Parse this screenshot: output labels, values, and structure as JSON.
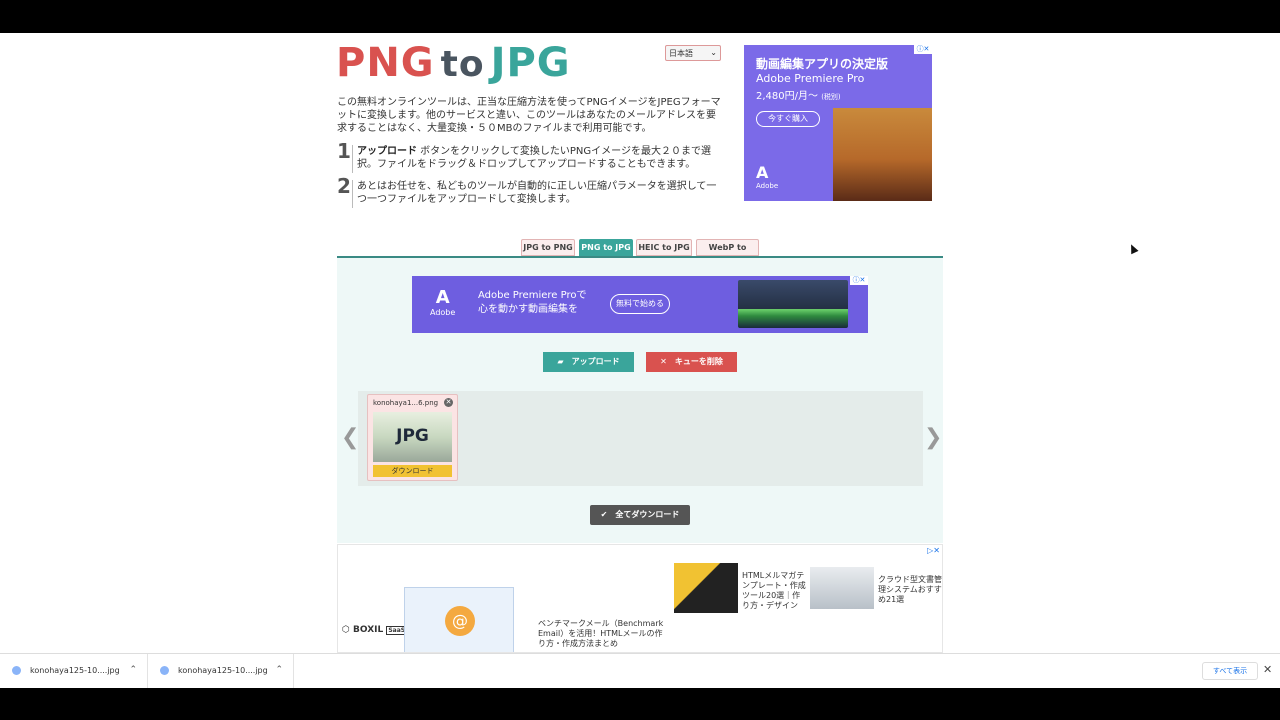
{
  "header": {
    "logo_left": "PNG",
    "logo_mid": "to",
    "logo_right": "JPG",
    "language": "日本語",
    "intro": "この無料オンラインツールは、正当な圧縮方法を使ってPNGイメージをJPEGフォーマットに変換します。他のサービスと違い、このツールはあなたのメールアドレスを要求することはなく、大量変換・５０MBのファイルまで利用可能です。",
    "steps": [
      {
        "num": "1",
        "bold": "アップロード",
        "text": " ボタンをクリックして変換したいPNGイメージを最大２０まで選択。ファイルをドラッグ＆ドロップしてアップロードすることもできます。"
      },
      {
        "num": "2",
        "bold": "",
        "text": "あとはお任せを、私どものツールが自動的に正しい圧縮パラメータを選択して一つ一つファイルをアップロードして変換します。"
      }
    ]
  },
  "ad_right": {
    "title": "動画編集アプリの決定版",
    "product": "Adobe Premiere Pro",
    "price": "2,480円/月～",
    "tax": "(税別)",
    "button": "今すぐ購入",
    "brand": "Adobe"
  },
  "tabs": [
    {
      "label": "JPG to PNG",
      "active": false
    },
    {
      "label": "PNG to JPG",
      "active": true
    },
    {
      "label": "HEIC to JPG",
      "active": false
    },
    {
      "label": "WebP to JPEG",
      "active": false
    }
  ],
  "ad_mid": {
    "brand": "Adobe",
    "line1": "Adobe Premiere Proで",
    "line2": "心を動かす動画編集を",
    "button": "無料で始める"
  },
  "actions": {
    "upload": "アップロード",
    "clear": "キューを削除",
    "download_all": "全てダウンロード"
  },
  "queue": {
    "files": [
      {
        "name": "konohaya1...6.png",
        "thumb_label": "JPG",
        "download": "ダウンロード"
      }
    ]
  },
  "ad_bottom": {
    "brand": "BOXIL",
    "brand_suffix": "SaaS",
    "item1": "ベンチマークメール（Benchmark Email）を活用！HTMLメールの作り方・作成方法まとめ",
    "item2": "HTMLメルマガテンプレート・作成ツール20選｜作り方・デザイン",
    "item3": "クラウド型文書管理システムおすすめ21選"
  },
  "downloads_bar": {
    "items": [
      "konohaya125-10....jpg",
      "konohaya125-10....jpg"
    ],
    "show_all": "すべて表示"
  },
  "colors": {
    "logo_red": "#d9524f",
    "logo_teal": "#3aa59b",
    "upload_btn": "#3aa59b",
    "clear_btn": "#d9524f",
    "ad_purple": "#7b6ae8"
  }
}
